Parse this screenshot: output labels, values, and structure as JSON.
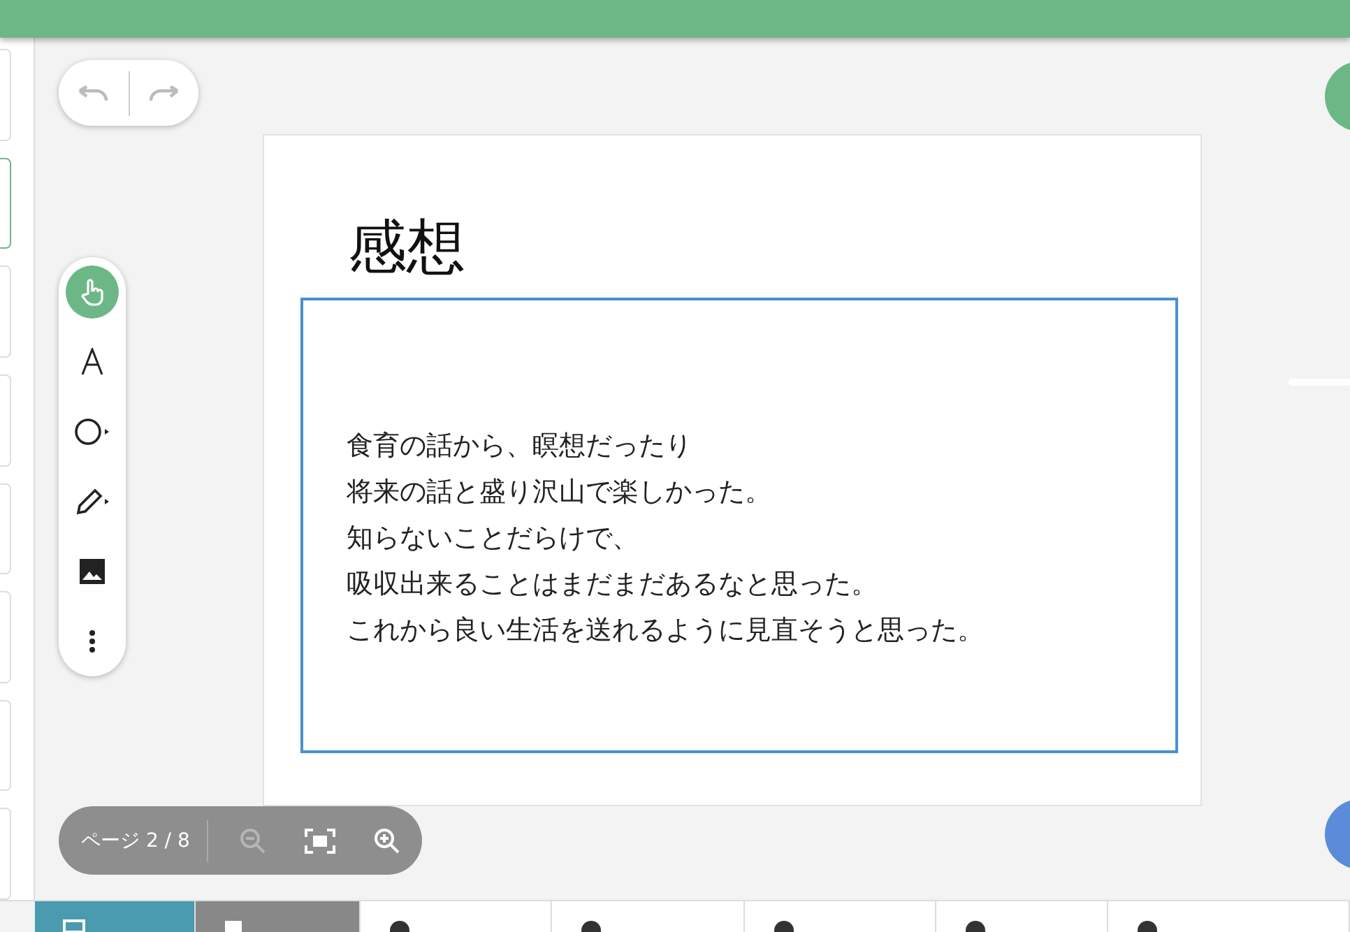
{
  "thumbnails": [
    {
      "selected": false
    },
    {
      "selected": true
    },
    {
      "selected": false
    },
    {
      "selected": false
    },
    {
      "selected": false
    },
    {
      "selected": false
    },
    {
      "selected": false
    },
    {
      "selected": false
    }
  ],
  "slide": {
    "title": "感想",
    "body": [
      "食育の話から、瞑想だったり",
      "将来の話と盛り沢山で楽しかった。",
      "知らないことだらけで、",
      "吸収出来ることはまだまだあるなと思った。",
      "これから良い生活を送れるように見直そうと思った。"
    ]
  },
  "tools": [
    {
      "kind": "pointer",
      "selected": true
    },
    {
      "kind": "text",
      "selected": false
    },
    {
      "kind": "shape",
      "selected": false
    },
    {
      "kind": "pen",
      "selected": false
    },
    {
      "kind": "image",
      "selected": false
    },
    {
      "kind": "more",
      "selected": false
    }
  ],
  "page_indicator": "ページ 2 / 8",
  "bottom_tabs": [
    {
      "kind": "list",
      "selected": true
    },
    {
      "kind": "card",
      "selected": false
    },
    {
      "kind": "user",
      "selected": false
    },
    {
      "kind": "user",
      "selected": false
    },
    {
      "kind": "user",
      "selected": false
    },
    {
      "kind": "user",
      "selected": false
    },
    {
      "kind": "user",
      "selected": false
    }
  ]
}
